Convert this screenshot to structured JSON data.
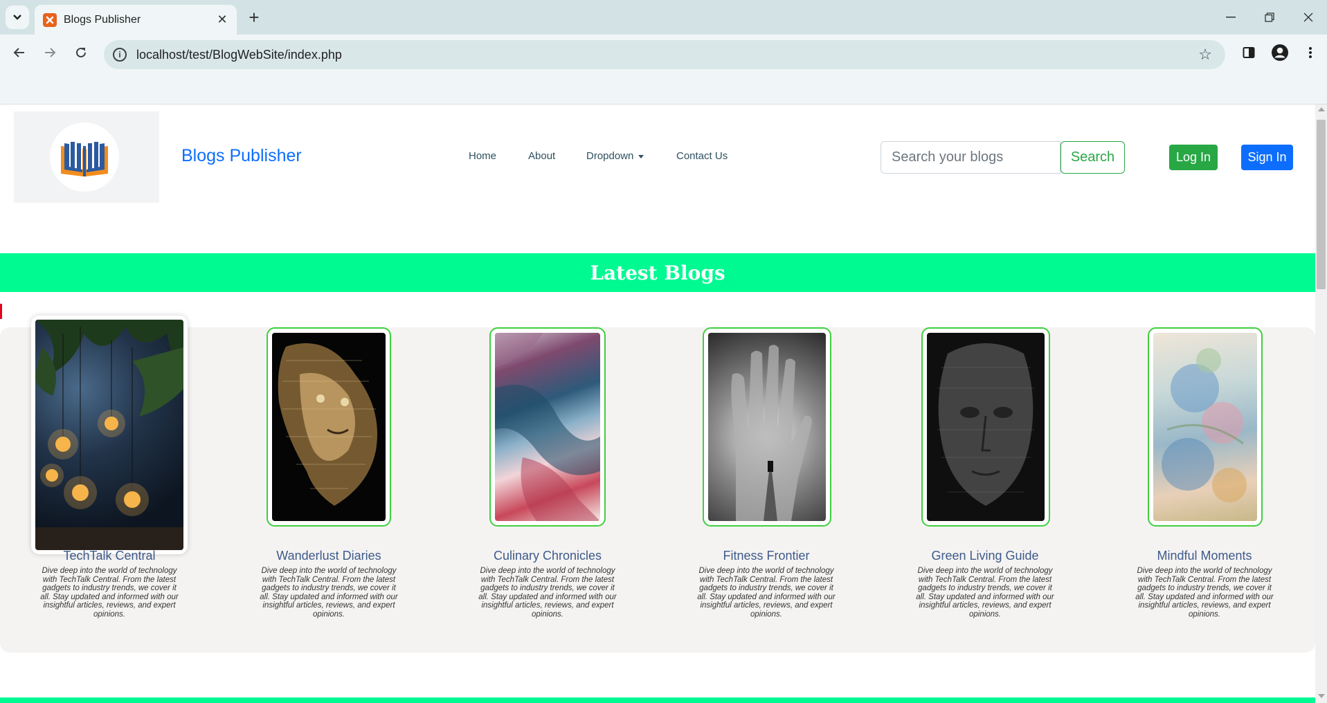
{
  "browser": {
    "tab_title": "Blogs Publisher",
    "url": "localhost/test/BlogWebSite/index.php"
  },
  "navbar": {
    "brand": "Blogs Publisher",
    "links": [
      "Home",
      "About",
      "Dropdown",
      "Contact Us"
    ],
    "search_placeholder": "Search your blogs",
    "search_label": "Search",
    "login_label": "Log In",
    "signin_label": "Sign In"
  },
  "section": {
    "title": "Latest Blogs"
  },
  "blogs": [
    {
      "title": "TechTalk Central",
      "description": "Dive deep into the world of technology with TechTalk Central. From the latest gadgets to industry trends, we cover it all. Stay updated and informed with our insightful articles, reviews, and expert opinions."
    },
    {
      "title": "Wanderlust Diaries",
      "description": "Dive deep into the world of technology with TechTalk Central. From the latest gadgets to industry trends, we cover it all. Stay updated and informed with our insightful articles, reviews, and expert opinions."
    },
    {
      "title": "Culinary Chronicles",
      "description": "Dive deep into the world of technology with TechTalk Central. From the latest gadgets to industry trends, we cover it all. Stay updated and informed with our insightful articles, reviews, and expert opinions."
    },
    {
      "title": "Fitness Frontier",
      "description": "Dive deep into the world of technology with TechTalk Central. From the latest gadgets to industry trends, we cover it all. Stay updated and informed with our insightful articles, reviews, and expert opinions."
    },
    {
      "title": "Green Living Guide",
      "description": "Dive deep into the world of technology with TechTalk Central. From the latest gadgets to industry trends, we cover it all. Stay updated and informed with our insightful articles, reviews, and expert opinions."
    },
    {
      "title": "Mindful Moments",
      "description": "Dive deep into the world of technology with TechTalk Central. From the latest gadgets to industry trends, we cover it all. Stay updated and informed with our insightful articles, reviews, and expert opinions."
    }
  ],
  "colors": {
    "accent_green": "#00fa92",
    "brand_blue": "#0d6efd",
    "success_green": "#28a745",
    "card_border": "#3ecf3e"
  }
}
